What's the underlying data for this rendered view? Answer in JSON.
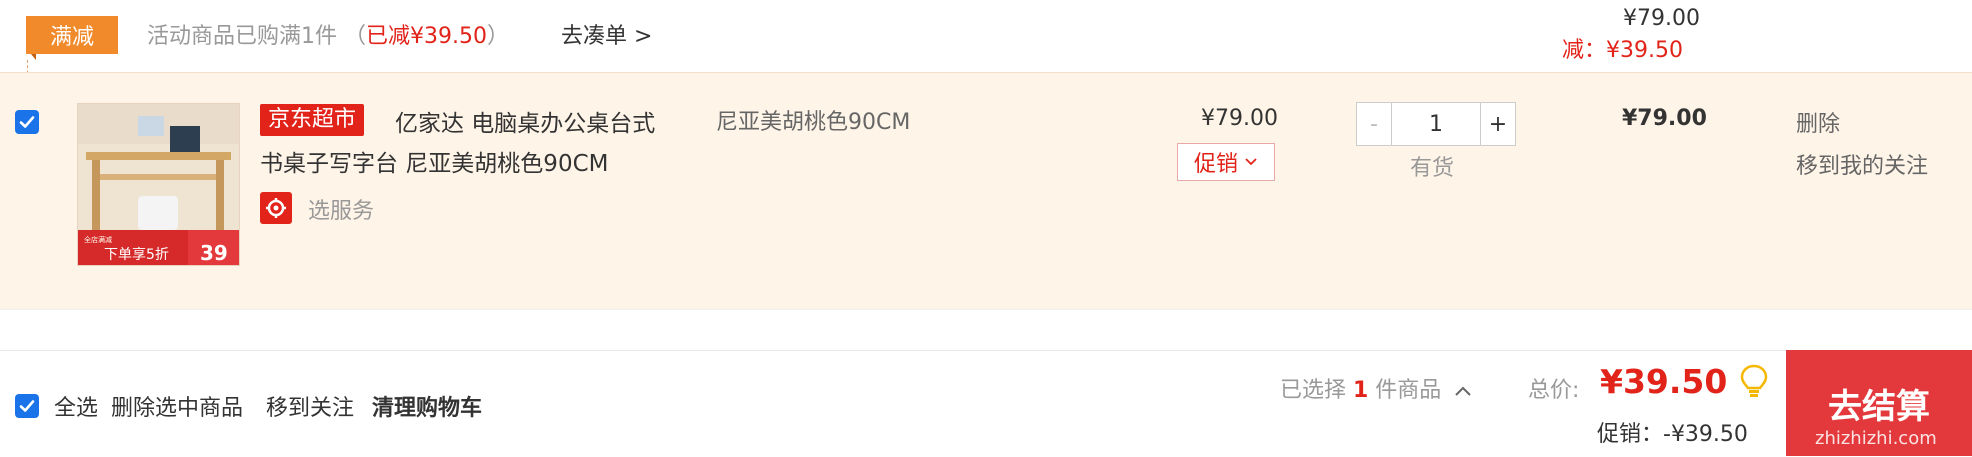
{
  "promo": {
    "tag": "满减",
    "text_prefix": "活动商品已购满1件 （",
    "text_reduced": "已减¥39.50",
    "text_suffix": "）",
    "link": "去凑单 >",
    "summary_price": "¥79.00",
    "summary_discount": "减：¥39.50"
  },
  "item": {
    "checked": true,
    "badge": "京东超市",
    "title_line1": "亿家达 电脑桌办公桌台式",
    "title_line2": "书桌子写字台 尼亚美胡桃色90CM",
    "service_label": "选服务",
    "variant": "尼亚美胡桃色90CM",
    "unit_price": "¥79.00",
    "promo_label": "促销",
    "quantity": "1",
    "minus": "-",
    "plus": "+",
    "stock": "有货",
    "subtotal": "¥79.00",
    "actions": {
      "delete": "删除",
      "follow": "移到我的关注"
    },
    "thumb": {
      "caption": "下单享5折",
      "price": "39"
    }
  },
  "footer": {
    "select_all": "全选",
    "delete_selected": "删除选中商品",
    "move_follow": "移到关注",
    "clear_cart": "清理购物车",
    "selected_prefix": "已选择 ",
    "selected_count": "1",
    "selected_suffix": " 件商品",
    "total_label": "总价:",
    "total_value": "¥39.50",
    "promo_sum": "促销：-¥39.50",
    "checkout": "去结算",
    "watermark": "zhizhizhi.com"
  },
  "colors": {
    "accent_red": "#e2231a",
    "promo_orange": "#f18a2b",
    "row_bg": "#fff4e8",
    "checkbox_blue": "#1a73e8"
  }
}
